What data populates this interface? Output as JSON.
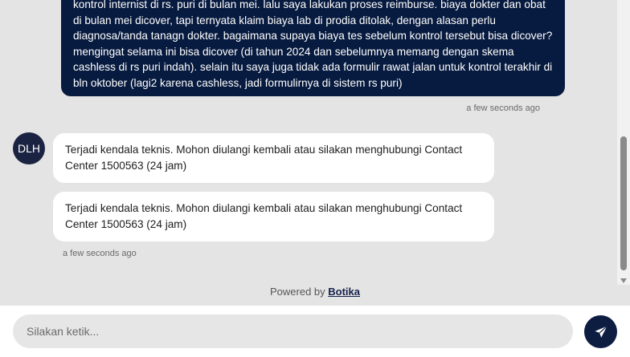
{
  "conversation": {
    "user_message": {
      "text": "kontrol internist di rs. puri di bulan mei. lalu saya lakukan proses reimburse. biaya dokter dan obat di bulan mei dicover, tapi ternyata klaim biaya lab di prodia ditolak, dengan alasan perlu diagnosa/tanda tanagn dokter. bagaimana supaya biaya tes sebelum kontrol tersebut bisa dicover?mengingat selama ini bisa dicover (di tahun 2024 dan sebelumnya memang dengan skema cashless di rs puri indah). selain itu saya juga tidak ada formulir rawat jalan untuk kontrol terakhir di bln oktober (lagi2 karena cashless, jadi formulirnya di sistem rs puri)",
      "timestamp": "a few seconds ago"
    },
    "bot": {
      "avatar_initials": "DLH",
      "messages": [
        "Terjadi kendala teknis. Mohon diulangi kembali atau silakan menghubungi Contact Center 1500563 (24 jam)",
        "Terjadi kendala teknis. Mohon diulangi kembali atau silakan menghubungi Contact Center 1500563 (24 jam)"
      ],
      "timestamp": "a few seconds ago"
    }
  },
  "footer": {
    "powered_by_text": "Powered by",
    "brand_link": "Botika"
  },
  "composer": {
    "placeholder": "Silakan ketik...",
    "value": "",
    "send_icon": "paper-plane-icon"
  },
  "colors": {
    "page_background": "#e4e4e4",
    "user_bubble": "#071a3f",
    "bot_bubble": "#ffffff",
    "send_button": "#0d1d42",
    "avatar": "#1b2342"
  }
}
